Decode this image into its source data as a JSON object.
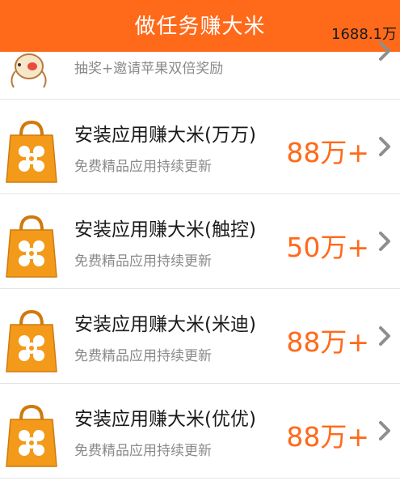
{
  "header": {
    "title": "做任务赚大米",
    "balance": "1688.1万"
  },
  "partial_item": {
    "subtitle": "抽奖+邀请苹果双倍奖励",
    "icon": "cartoon-character-icon"
  },
  "items": [
    {
      "title": "安装应用赚大米(万万)",
      "subtitle": "免费精品应用持续更新",
      "reward": "88万+",
      "icon": "shopping-bag-icon"
    },
    {
      "title": "安装应用赚大米(触控)",
      "subtitle": "免费精品应用持续更新",
      "reward": "50万+",
      "icon": "shopping-bag-icon"
    },
    {
      "title": "安装应用赚大米(米迪)",
      "subtitle": "免费精品应用持续更新",
      "reward": "88万+",
      "icon": "shopping-bag-icon"
    },
    {
      "title": "安装应用赚大米(优优)",
      "subtitle": "免费精品应用持续更新",
      "reward": "88万+",
      "icon": "shopping-bag-icon"
    }
  ],
  "colors": {
    "accent": "#ff6a1a",
    "bag": "#f39a1a",
    "bag_dark": "#d07a0c"
  }
}
